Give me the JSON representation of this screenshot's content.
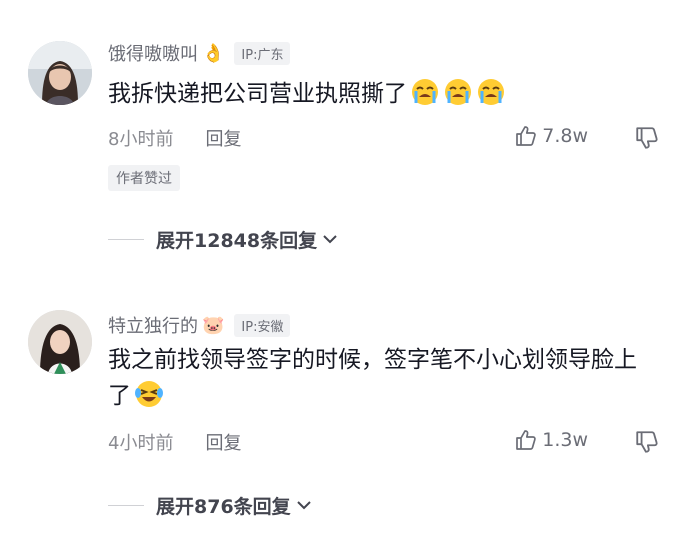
{
  "comments": [
    {
      "username": "饿得嗷嗷叫",
      "name_emoji": "👌",
      "ip": "IP:广东",
      "text": "我拆快递把公司营业执照撕了",
      "trailing_emojis": [
        "crying-face-icon",
        "crying-face-icon",
        "crying-face-icon"
      ],
      "time": "8小时前",
      "reply_label": "回复",
      "likes": "7.8w",
      "author_liked_label": "作者赞过",
      "expand_label": "展开12848条回复"
    },
    {
      "username": "特立独行的",
      "name_emoji": "🐷",
      "ip": "IP:安徽",
      "text": "我之前找领导签字的时候，签字笔不小心划领导脸上了",
      "trailing_emojis": [
        "laughing-tears-icon"
      ],
      "time": "4小时前",
      "reply_label": "回复",
      "likes": "1.3w",
      "expand_label": "展开876条回复"
    }
  ],
  "colors": {
    "text_primary": "#161823",
    "text_secondary": "#6b6d76",
    "badge_bg": "#f1f2f4"
  }
}
